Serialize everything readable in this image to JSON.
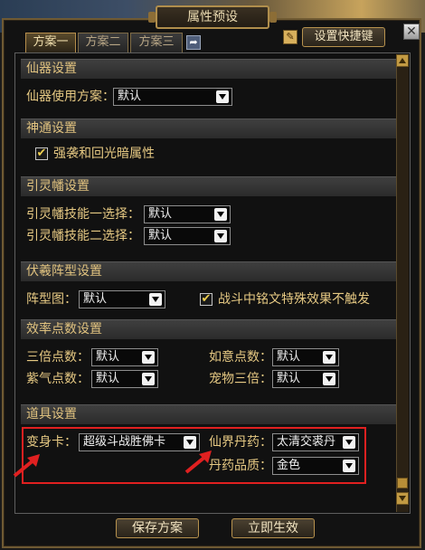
{
  "window": {
    "title": "属性预设"
  },
  "tabs": [
    {
      "label": "方案一",
      "active": true
    },
    {
      "label": "方案二",
      "active": false
    },
    {
      "label": "方案三",
      "active": false
    }
  ],
  "toolbar": {
    "shortcut_label": "设置快捷键",
    "close_symbol": "✕",
    "edit_icon": "pencil-icon",
    "arrow_icon": "export-icon"
  },
  "sections": {
    "immortal": {
      "title": "仙器设置",
      "label": "仙器使用方案：",
      "value": "默认"
    },
    "divine": {
      "title": "神通设置",
      "checkbox_label": "强袭和回光暗属性",
      "checked": true
    },
    "banner": {
      "title": "引灵幡设置",
      "skill1_label": "引灵幡技能一选择：",
      "skill1_value": "默认",
      "skill2_label": "引灵幡技能二选择：",
      "skill2_value": "默认"
    },
    "formation": {
      "title": "伏羲阵型设置",
      "label": "阵型图：",
      "value": "默认",
      "checkbox_label": "战斗中铭文特殊效果不触发",
      "checked": true
    },
    "efficiency": {
      "title": "效率点数设置",
      "triple_label": "三倍点数：",
      "triple_value": "默认",
      "ruyi_label": "如意点数：",
      "ruyi_value": "默认",
      "purple_label": "紫气点数：",
      "purple_value": "默认",
      "pet_label": "宠物三倍：",
      "pet_value": "默认"
    },
    "items": {
      "title": "道具设置",
      "transform_label": "变身卡：",
      "transform_value": "超级斗战胜佛卡",
      "elixir_label": "仙界丹药：",
      "elixir_value": "太清交裘丹",
      "quality_label": "丹药品质：",
      "quality_value": "金色"
    }
  },
  "footer": {
    "save_label": "保存方案",
    "apply_label": "立即生效"
  },
  "colors": {
    "accent": "#e6c983",
    "highlight": "#e02020"
  }
}
